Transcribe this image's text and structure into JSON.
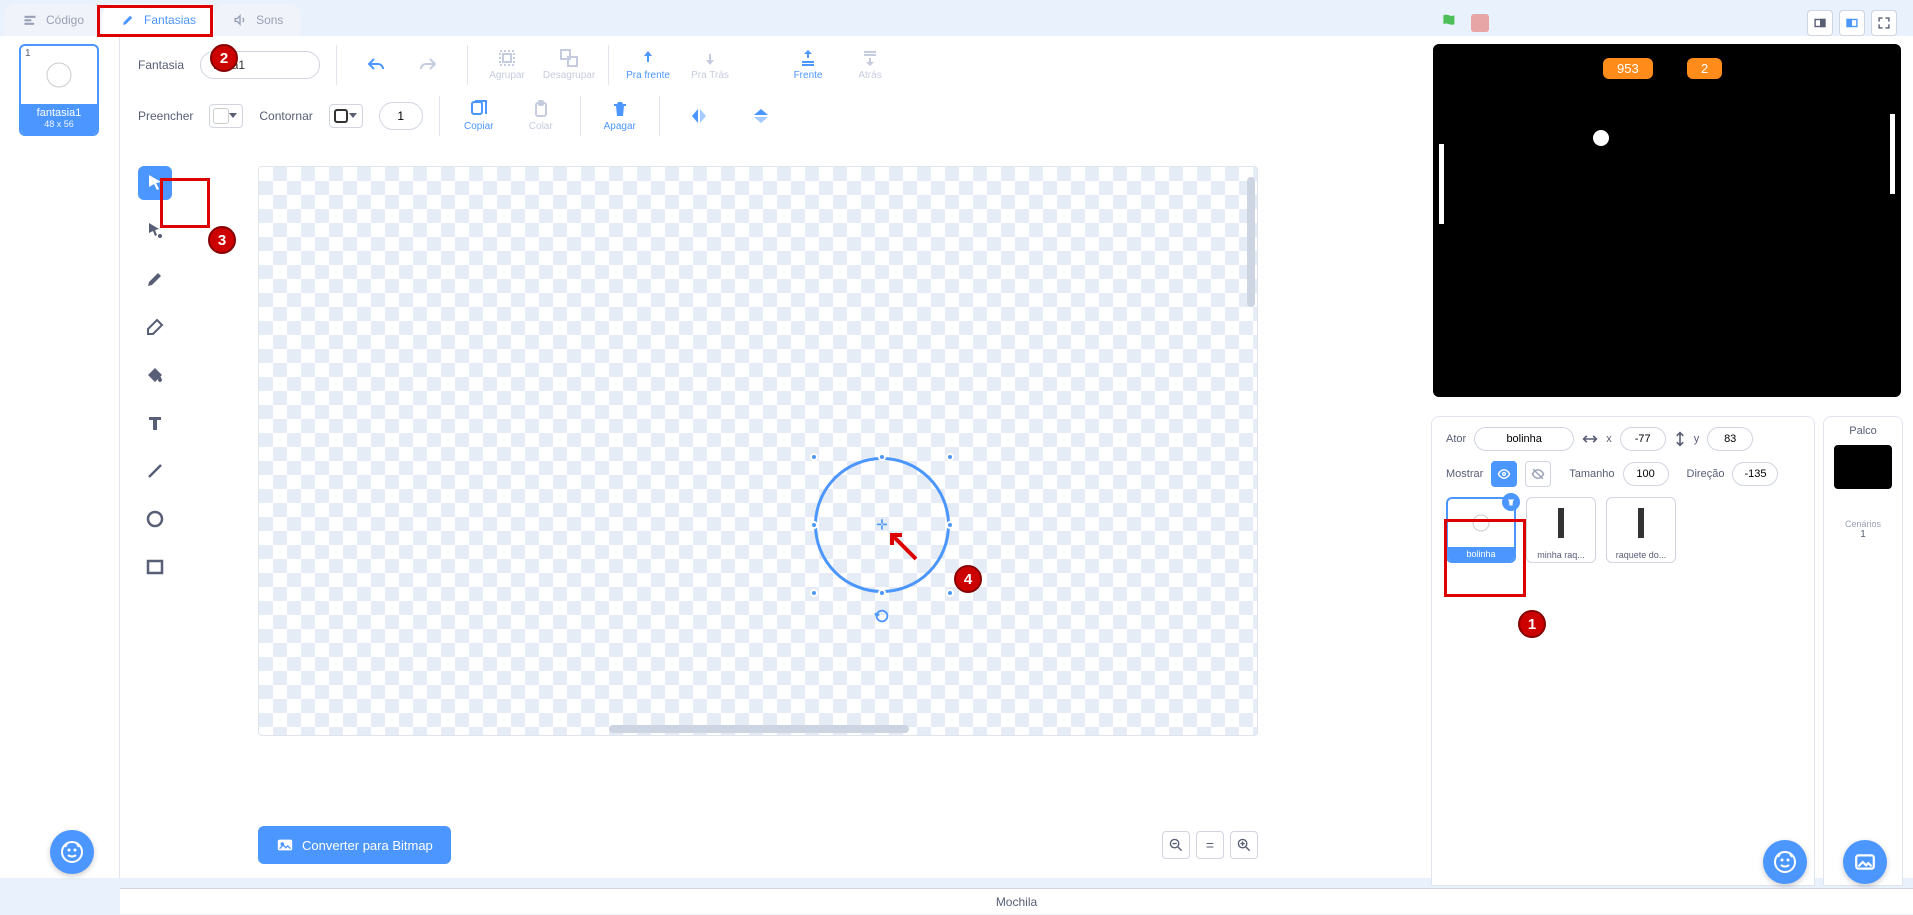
{
  "tabs": {
    "code": "Código",
    "costumes": "Fantasias",
    "sounds": "Sons"
  },
  "costume_list": [
    {
      "index": "1",
      "name": "fantasia1",
      "dim": "48 x 56"
    }
  ],
  "toolbar": {
    "name_label": "Fantasia",
    "name_value": "tasia1",
    "group": "Agrupar",
    "ungroup": "Desagrupar",
    "forward": "Pra frente",
    "backward": "Pra Trás",
    "front": "Frente",
    "back": "Atrás",
    "fill_label": "Preencher",
    "outline_label": "Contornar",
    "outline_width": "1",
    "copy": "Copiar",
    "paste": "Colar",
    "delete": "Apagar"
  },
  "bitmap_btn": "Converter para Bitmap",
  "stage": {
    "score1": "953",
    "score2": "2"
  },
  "sprite_panel": {
    "actor_label": "Ator",
    "actor_name": "bolinha",
    "x_label": "x",
    "x_value": "-77",
    "y_label": "y",
    "y_value": "83",
    "show_label": "Mostrar",
    "size_label": "Tamanho",
    "size_value": "100",
    "dir_label": "Direção",
    "dir_value": "-135",
    "sprites": [
      {
        "name": "bolinha",
        "selected": true
      },
      {
        "name": "minha raq...",
        "selected": false
      },
      {
        "name": "raquete do...",
        "selected": false
      }
    ]
  },
  "stage_col": {
    "title": "Palco",
    "backdrops_label": "Cenários",
    "backdrops_count": "1"
  },
  "backpack": "Mochila",
  "callouts": {
    "c1": "1",
    "c2": "2",
    "c3": "3",
    "c4": "4"
  }
}
